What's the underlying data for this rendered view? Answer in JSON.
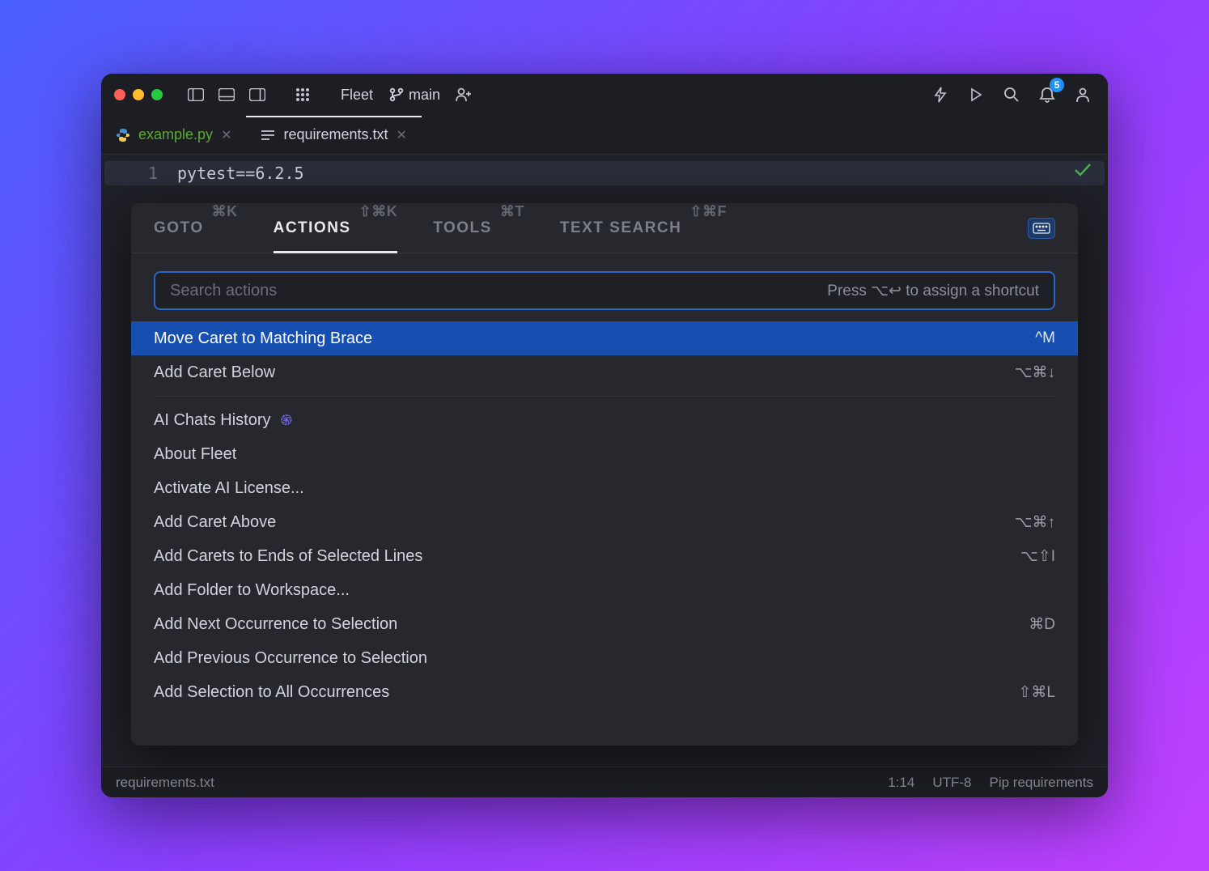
{
  "titlebar": {
    "app_name": "Fleet",
    "branch": "main",
    "notification_count": "5"
  },
  "tabs": [
    {
      "name": "example.py",
      "icon": "python-icon",
      "active": false
    },
    {
      "name": "requirements.txt",
      "icon": "lines-icon",
      "active": true
    }
  ],
  "editor": {
    "line_number": "1",
    "code": "pytest==6.2.5"
  },
  "palette": {
    "tabs": [
      {
        "label": "GOTO",
        "shortcut": "⌘K"
      },
      {
        "label": "ACTIONS",
        "shortcut": "⇧⌘K",
        "active": true
      },
      {
        "label": "TOOLS",
        "shortcut": "⌘T"
      },
      {
        "label": "TEXT SEARCH",
        "shortcut": "⇧⌘F"
      }
    ],
    "search_placeholder": "Search actions",
    "search_hint": "Press ⌥↩ to assign a shortcut",
    "group1": [
      {
        "label": "Move Caret to Matching Brace",
        "shortcut": "^M",
        "selected": true
      },
      {
        "label": "Add Caret Below",
        "shortcut": "⌥⌘↓"
      }
    ],
    "group2": [
      {
        "label": "AI Chats History",
        "icon": "spiral"
      },
      {
        "label": "About Fleet"
      },
      {
        "label": "Activate AI License..."
      },
      {
        "label": "Add Caret Above",
        "shortcut": "⌥⌘↑"
      },
      {
        "label": "Add Carets to Ends of Selected Lines",
        "shortcut": "⌥⇧I"
      },
      {
        "label": "Add Folder to Workspace..."
      },
      {
        "label": "Add Next Occurrence to Selection",
        "shortcut": "⌘D"
      },
      {
        "label": "Add Previous Occurrence to Selection"
      },
      {
        "label": "Add Selection to All Occurrences",
        "shortcut": "⇧⌘L"
      }
    ]
  },
  "statusbar": {
    "file": "requirements.txt",
    "position": "1:14",
    "encoding": "UTF-8",
    "file_type": "Pip requirements"
  }
}
